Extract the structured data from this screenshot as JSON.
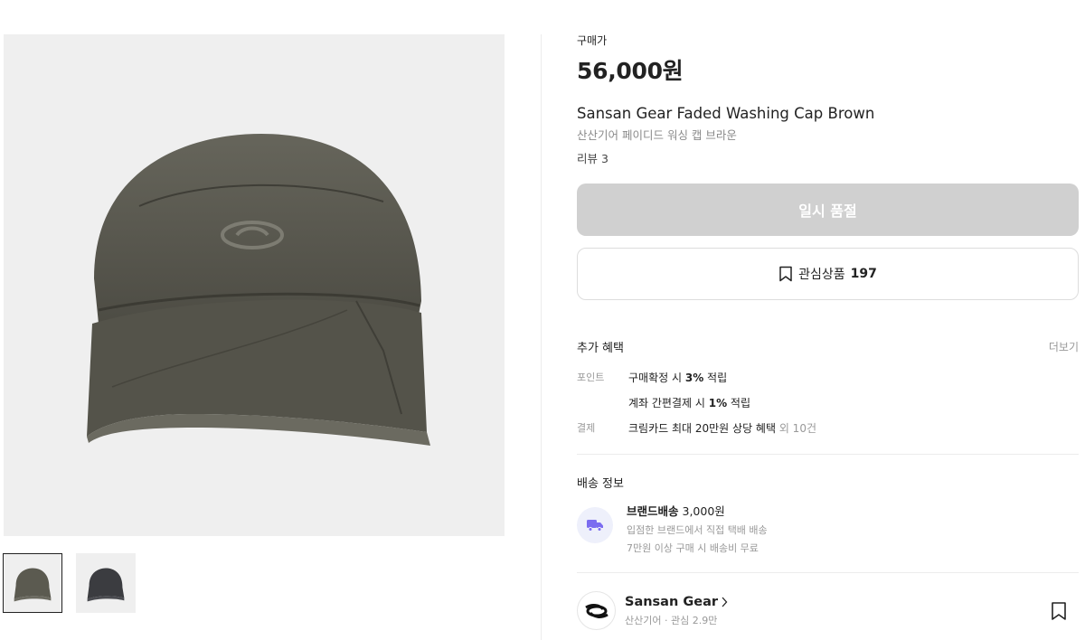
{
  "product": {
    "price_label": "구매가",
    "price": "56,000원",
    "name_en": "Sansan Gear Faded Washing Cap Brown",
    "name_ko": "산산기어 페이디드 워싱 캡 브라운",
    "reviews": "리뷰 3",
    "image_icon": "cap-image",
    "cap_color": "#5b5a50"
  },
  "gallery": {
    "thumbnails": [
      {
        "name": "brown-cap-thumbnail",
        "color": "#5b5a50",
        "active": true
      },
      {
        "name": "charcoal-cap-thumbnail",
        "color": "#3b3c40",
        "active": false
      }
    ]
  },
  "actions": {
    "soldout_label": "일시 품절",
    "wish_label": "관심상품",
    "wish_count": "197"
  },
  "benefits": {
    "title": "추가 혜택",
    "more": "더보기",
    "point_label": "포인트",
    "point_1_prefix": "구매확정 시 ",
    "point_1_bold": "3%",
    "point_1_suffix": " 적립",
    "point_2_prefix": "계좌 간편결제 시 ",
    "point_2_bold": "1%",
    "point_2_suffix": " 적립",
    "payment_label": "결제",
    "payment_text": "크림카드 최대 20만원 상당 혜택",
    "payment_extra": " 외 10건"
  },
  "shipping": {
    "title": "배송 정보",
    "method_bold": "브랜드배송",
    "method_fee": " 3,000원",
    "line_1": "입점한 브랜드에서 직접 택배 배송",
    "line_2": "7만원 이상 구매 시 배송비 무료",
    "icon": "truck-icon",
    "icon_color": "#7b6cf0"
  },
  "brand": {
    "name": "Sansan Gear",
    "meta": "산산기어 · 관심 2.9만"
  }
}
